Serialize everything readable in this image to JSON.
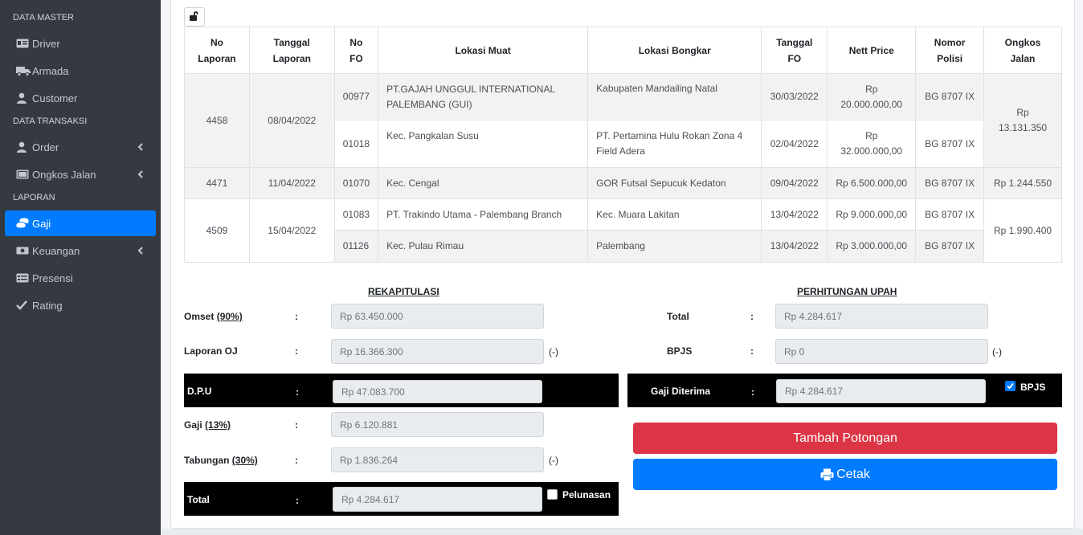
{
  "sidebar": {
    "sections": [
      {
        "header": "DATA MASTER",
        "items": [
          {
            "label": "Driver",
            "icon": "id-card-icon"
          },
          {
            "label": "Armada",
            "icon": "truck-icon"
          },
          {
            "label": "Customer",
            "icon": "user-icon"
          }
        ]
      },
      {
        "header": "DATA TRANSAKSI",
        "items": [
          {
            "label": "Order",
            "icon": "user-icon",
            "has_children": true
          },
          {
            "label": "Ongkos Jalan",
            "icon": "money-icon",
            "has_children": true
          }
        ]
      },
      {
        "header": "LAPORAN",
        "items": [
          {
            "label": "Gaji",
            "icon": "coins-icon",
            "active": true
          },
          {
            "label": "Keuangan",
            "icon": "money-bill-icon",
            "has_children": true
          },
          {
            "label": "Presensi",
            "icon": "id-badge-icon"
          },
          {
            "label": "Rating",
            "icon": "check-icon"
          }
        ]
      }
    ]
  },
  "table": {
    "headers": [
      {
        "l1": "No",
        "l2": "Laporan"
      },
      {
        "l1": "Tanggal",
        "l2": "Laporan"
      },
      {
        "l1": "No",
        "l2": "FO"
      },
      {
        "l1": "Lokasi Muat",
        "l2": ""
      },
      {
        "l1": "Lokasi Bongkar",
        "l2": ""
      },
      {
        "l1": "Tanggal",
        "l2": "FO"
      },
      {
        "l1": "Nett Price",
        "l2": ""
      },
      {
        "l1": "Nomor",
        "l2": "Polisi"
      },
      {
        "l1": "Ongkos",
        "l2": "Jalan"
      }
    ],
    "groups": [
      {
        "no_laporan": "4458",
        "tanggal_laporan": "08/04/2022",
        "ongkos_jalan": "Rp 13.131.350",
        "rows": [
          {
            "no_fo": "00977",
            "lokasi_muat": "PT.GAJAH UNGGUL INTERNATIONAL PALEMBANG (GUI)",
            "lokasi_bongkar": "Kabupaten Mandailing Natal",
            "tanggal_fo": "30/03/2022",
            "nett_price": "Rp 20.000.000,00",
            "nomor_polisi": "BG 8707 IX"
          },
          {
            "no_fo": "01018",
            "lokasi_muat": "Kec. Pangkalan Susu",
            "lokasi_bongkar": "PT. Pertamina Hulu Rokan Zona 4 Field Adera",
            "tanggal_fo": "02/04/2022",
            "nett_price": "Rp 32.000.000,00",
            "nomor_polisi": "BG 8707 IX"
          }
        ]
      },
      {
        "no_laporan": "4471",
        "tanggal_laporan": "11/04/2022",
        "ongkos_jalan": "Rp 1.244.550",
        "rows": [
          {
            "no_fo": "01070",
            "lokasi_muat": "Kec. Cengal",
            "lokasi_bongkar": "GOR Futsal Sepucuk Kedaton",
            "tanggal_fo": "09/04/2022",
            "nett_price": "Rp 6.500.000,00",
            "nomor_polisi": "BG 8707 IX"
          }
        ]
      },
      {
        "no_laporan": "4509",
        "tanggal_laporan": "15/04/2022",
        "ongkos_jalan": "Rp 1.990.400",
        "rows": [
          {
            "no_fo": "01083",
            "lokasi_muat": "PT. Trakindo Utama - Palembang Branch",
            "lokasi_bongkar": "Kec. Muara Lakitan",
            "tanggal_fo": "13/04/2022",
            "nett_price": "Rp 9.000.000,00",
            "nomor_polisi": "BG 8707 IX"
          },
          {
            "no_fo": "01126",
            "lokasi_muat": "Kec. Pulau Rimau",
            "lokasi_bongkar": "Palembang",
            "tanggal_fo": "13/04/2022",
            "nett_price": "Rp 3.000.000,00",
            "nomor_polisi": "BG 8707 IX"
          }
        ]
      }
    ]
  },
  "rekap": {
    "title": "REKAPITULASI",
    "omset_label": "Omset",
    "omset_pct": "(90%)",
    "omset_value": "Rp 63.450.000",
    "laporan_oj_label": "Laporan OJ",
    "laporan_oj_value": "Rp 16.366.300",
    "dpu_label": "D.P.U",
    "dpu_value": "Rp 47.083.700",
    "gaji_label": "Gaji",
    "gaji_pct": "(13%)",
    "gaji_value": "Rp 6.120.881",
    "tabungan_label": "Tabungan",
    "tabungan_pct": "(30%)",
    "tabungan_value": "Rp 1.836.264",
    "total_label": "Total",
    "total_value": "Rp 4.284.617",
    "pelunasan_label": "Pelunasan",
    "colon": ":",
    "minus": "(-)"
  },
  "upah": {
    "title": "PERHITUNGAN UPAH",
    "total_label": "Total",
    "total_value": "Rp 4.284.617",
    "bpjs_label": "BPJS",
    "bpjs_value": "Rp 0",
    "gaji_diterima_label": "Gaji Diterima",
    "gaji_diterima_value": "Rp 4.284.617",
    "bpjs_check_label": "BPJS",
    "bpjs_checked": true
  },
  "buttons": {
    "tambah_potongan": "Tambah Potongan",
    "cetak": "Cetak"
  },
  "colors": {
    "sidebar_bg": "#343a40",
    "active": "#007bff",
    "danger": "#dc3545"
  }
}
